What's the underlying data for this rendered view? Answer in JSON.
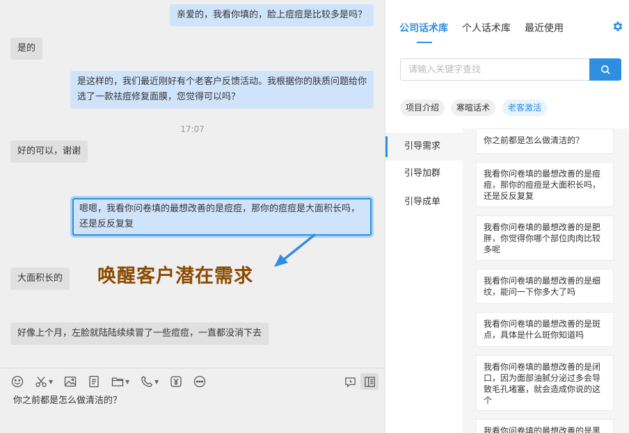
{
  "chat": {
    "messages": [
      {
        "text": "亲爱的，我看你填的，脸上痘痘是比较多是吗？"
      },
      {
        "text": "是的"
      },
      {
        "text": "是这样的，我们最近刚好有个老客户反馈活动。我根据你的肤质问题给你选了一款祛痘修复面膜，您觉得可以吗？"
      },
      {
        "text": "好的可以，谢谢"
      },
      {
        "text": "嗯嗯，我看你问卷填的最想改善的是痘痘，那你的痘痘是大面积长吗，还是反反复复"
      },
      {
        "text": "大面积长的"
      },
      {
        "text": "好像上个月，左脸就陆陆续续冒了一些痘痘，一直都没消下去"
      }
    ],
    "timestamp": "17:07",
    "annotation": "唤醒客户潜在需求",
    "composer_text": "你之前都是怎么做清洁的？"
  },
  "colors": {
    "accent": "#2e8fe0",
    "annotation": "#8a4a00",
    "sent_bubble": "#cfe4fb",
    "recv_bubble": "#e0e0e0"
  },
  "side": {
    "tabs": [
      {
        "label": "公司话术库"
      },
      {
        "label": "个人话术库"
      },
      {
        "label": "最近使用"
      }
    ],
    "search_placeholder": "请输入关键字查找",
    "chips": [
      {
        "label": "项目介绍"
      },
      {
        "label": "寒暄话术"
      },
      {
        "label": "老客激活"
      }
    ],
    "categories": [
      {
        "label": "引导需求"
      },
      {
        "label": "引导加群"
      },
      {
        "label": "引导成单"
      }
    ],
    "scripts": [
      {
        "text": "你之前都是怎么做清洁的？"
      },
      {
        "text": "我看你问卷填的最想改善的是痘痘，那你的痘痘是大面积长吗，还是反反复复"
      },
      {
        "text": "我看你问卷填的最想改善的是肥胖，你觉得你哪个部位肉肉比较多呢"
      },
      {
        "text": "我看你问卷填的最想改善的是细纹，能问一下你多大了吗"
      },
      {
        "text": "我看你问卷填的最想改善的是斑点，具体是什么斑你知道吗"
      },
      {
        "text": "我看你问卷填的最想改善的是闭口，因为面部油腻分泌过多会导致毛孔堵塞，就会造成你说的这个"
      },
      {
        "text": "我看你问卷填的最想改善的是黑"
      }
    ]
  }
}
